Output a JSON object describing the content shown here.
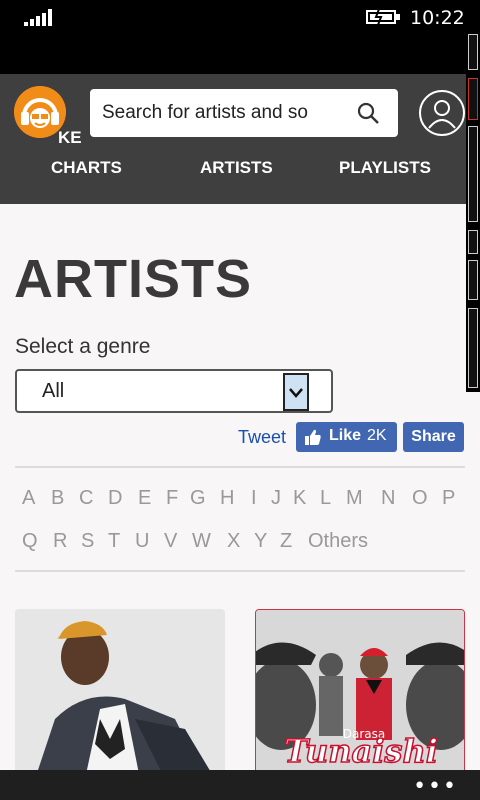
{
  "status_bar": {
    "time": "10:22"
  },
  "header": {
    "logo_text": "KE",
    "search_placeholder": "Search for artists and so",
    "nav": [
      {
        "label": "CHARTS"
      },
      {
        "label": "ARTISTS"
      },
      {
        "label": "PLAYLISTS"
      }
    ]
  },
  "page": {
    "title": "ARTISTS",
    "genre_label": "Select a genre",
    "genre_selected": "All",
    "social": {
      "tweet": "Tweet",
      "like": "Like",
      "like_count": "2K",
      "share": "Share"
    },
    "alphabet_row1": [
      "A",
      "B",
      "C",
      "D",
      "E",
      "F",
      "G",
      "H",
      "I",
      "J",
      "K",
      "L",
      "M",
      "N",
      "O",
      "P"
    ],
    "alphabet_row2": [
      "Q",
      "R",
      "S",
      "T",
      "U",
      "V",
      "W",
      "X",
      "Y",
      "Z",
      "Others"
    ],
    "cards": [
      {
        "caption": ""
      },
      {
        "caption": "Tunaishi",
        "sub": "Darasa"
      }
    ]
  },
  "colors": {
    "brand_orange": "#f28c18",
    "header_bg": "#3f3f3f",
    "facebook_blue": "#4267b2"
  },
  "app_bar": {
    "more": "•••"
  }
}
